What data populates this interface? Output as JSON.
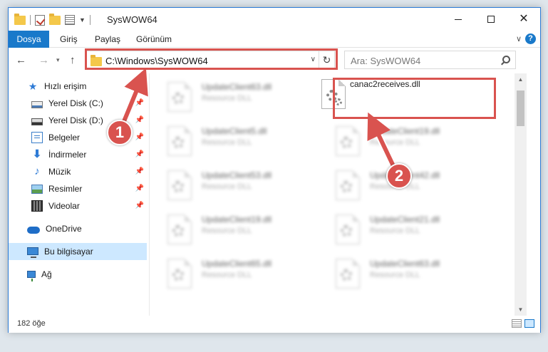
{
  "window": {
    "title": "SysWOW64"
  },
  "ribbon": {
    "tabs": [
      "Dosya",
      "Giriş",
      "Paylaş",
      "Görünüm"
    ]
  },
  "address": {
    "path": "C:\\Windows\\SysWOW64"
  },
  "search": {
    "placeholder": "Ara: SysWOW64"
  },
  "sidebar": {
    "items": [
      {
        "label": "Hızlı erişim",
        "icon": "star-icon"
      },
      {
        "label": "Yerel Disk (C:)",
        "icon": "disk-icon"
      },
      {
        "label": "Yerel Disk (D:)",
        "icon": "disk-icon"
      },
      {
        "label": "Belgeler",
        "icon": "documents-icon"
      },
      {
        "label": "İndirmeler",
        "icon": "download-icon"
      },
      {
        "label": "Müzik",
        "icon": "music-icon"
      },
      {
        "label": "Resimler",
        "icon": "pictures-icon"
      },
      {
        "label": "Videolar",
        "icon": "video-icon"
      },
      {
        "label": "OneDrive",
        "icon": "cloud-icon"
      },
      {
        "label": "Bu bilgisayar",
        "icon": "computer-icon"
      },
      {
        "label": "Ağ",
        "icon": "network-icon"
      }
    ]
  },
  "files": {
    "highlighted": {
      "name": "canac2receives.dll"
    },
    "left": [
      {
        "name": "UpdateClient63.dll",
        "type": "Resource DLL"
      },
      {
        "name": "UpdateClient5.dll",
        "type": "Resource DLL"
      },
      {
        "name": "UpdateClient53.dll",
        "type": "Resource DLL"
      },
      {
        "name": "UpdateClient19.dll",
        "type": "Resource DLL"
      },
      {
        "name": "UpdateClient65.dll",
        "type": "Resource DLL"
      }
    ],
    "right": [
      {
        "name": "UpdateClient19.dll",
        "type": "Resource DLL"
      },
      {
        "name": "UpdateClient42.dll",
        "type": "Resource DLL"
      },
      {
        "name": "UpdateClient21.dll",
        "type": "Resource DLL"
      },
      {
        "name": "UpdateClient63.dll",
        "type": "Resource DLL"
      }
    ]
  },
  "status": {
    "count": "182 öğe"
  },
  "annotations": {
    "step1": "1",
    "step2": "2",
    "color": "#d9534f"
  },
  "colors": {
    "accent": "#1979ca",
    "selection": "#cde8ff"
  }
}
